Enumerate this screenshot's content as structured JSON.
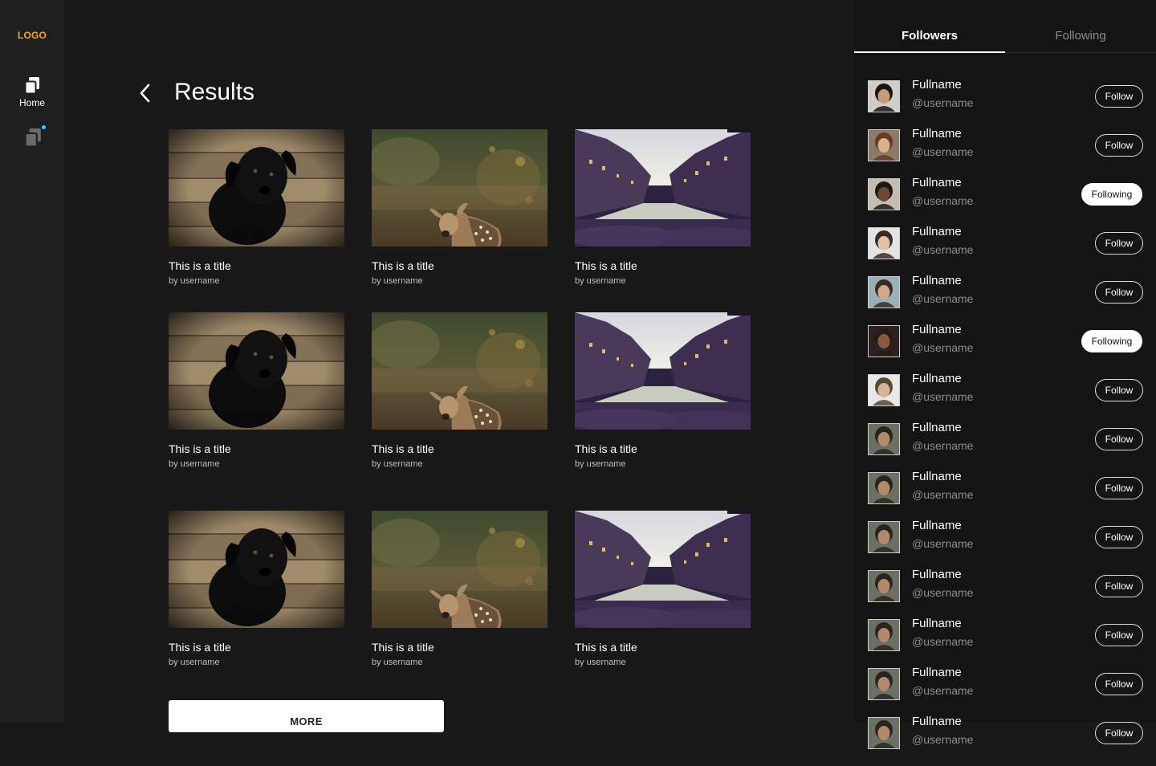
{
  "sidebar": {
    "logo": "LOGO",
    "home_label": "Home",
    "home_icon": "collection-stack-icon",
    "second_icon": "collection-stack-notification-icon",
    "notification_color": "#4fc3f7",
    "logo_color": "#f5a623"
  },
  "main": {
    "page_title": "Results",
    "back_icon": "chevron-left-icon",
    "cards": [
      {
        "title": "This is a title",
        "byline": "by username",
        "image": "black-dog-on-wood"
      },
      {
        "title": "This is a title",
        "byline": "by username",
        "image": "fawn-in-forest"
      },
      {
        "title": "This is a title",
        "byline": "by username",
        "image": "canal-city-street"
      },
      {
        "title": "This is a title",
        "byline": "by username",
        "image": "black-dog-on-wood"
      },
      {
        "title": "This is a title",
        "byline": "by username",
        "image": "fawn-in-forest"
      },
      {
        "title": "This is a title",
        "byline": "by username",
        "image": "canal-city-street"
      },
      {
        "title": "This is a title",
        "byline": "by username",
        "image": "black-dog-on-wood"
      },
      {
        "title": "This is a title",
        "byline": "by username",
        "image": "fawn-in-forest"
      },
      {
        "title": "This is a title",
        "byline": "by username",
        "image": "canal-city-street"
      }
    ],
    "more_label": "MORE"
  },
  "panel": {
    "tabs": [
      {
        "label": "Followers",
        "active": true
      },
      {
        "label": "Following",
        "active": false
      }
    ],
    "users": [
      {
        "fullname": "Fullname",
        "username": "@username",
        "action": "Follow",
        "state": "follow"
      },
      {
        "fullname": "Fullname",
        "username": "@username",
        "action": "Follow",
        "state": "follow"
      },
      {
        "fullname": "Fullname",
        "username": "@username",
        "action": "Following",
        "state": "following"
      },
      {
        "fullname": "Fullname",
        "username": "@username",
        "action": "Follow",
        "state": "follow"
      },
      {
        "fullname": "Fullname",
        "username": "@username",
        "action": "Follow",
        "state": "follow"
      },
      {
        "fullname": "Fullname",
        "username": "@username",
        "action": "Following",
        "state": "following"
      },
      {
        "fullname": "Fullname",
        "username": "@username",
        "action": "Follow",
        "state": "follow"
      },
      {
        "fullname": "Fullname",
        "username": "@username",
        "action": "Follow",
        "state": "follow"
      },
      {
        "fullname": "Fullname",
        "username": "@username",
        "action": "Follow",
        "state": "follow"
      },
      {
        "fullname": "Fullname",
        "username": "@username",
        "action": "Follow",
        "state": "follow"
      },
      {
        "fullname": "Fullname",
        "username": "@username",
        "action": "Follow",
        "state": "follow"
      },
      {
        "fullname": "Fullname",
        "username": "@username",
        "action": "Follow",
        "state": "follow"
      },
      {
        "fullname": "Fullname",
        "username": "@username",
        "action": "Follow",
        "state": "follow"
      },
      {
        "fullname": "Fullname",
        "username": "@username",
        "action": "Follow",
        "state": "follow"
      }
    ]
  }
}
